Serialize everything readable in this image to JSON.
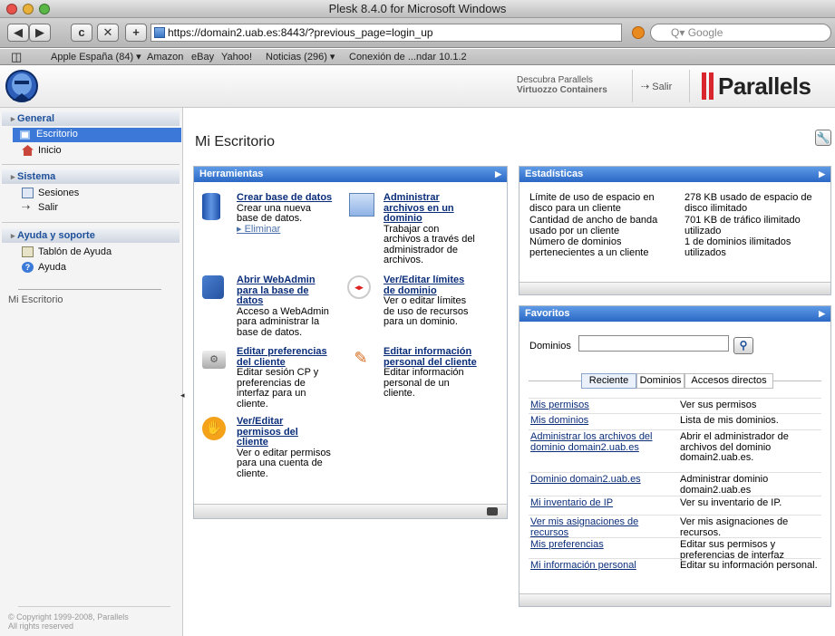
{
  "window": {
    "title": "Plesk 8.4.0 for Microsoft Windows"
  },
  "toolbar": {
    "back": "◀",
    "forward": "▶",
    "reload": "c",
    "stop": "✕",
    "add": "+",
    "url": "https://domain2.uab.es:8443/?previous_page=login_up",
    "search_placeholder": "Q▾ Google"
  },
  "bookmarks": {
    "book_icon": "◫",
    "items": [
      "Apple España (84) ▾",
      "Amazon",
      "eBay",
      "Yahoo!",
      "Noticias (296) ▾",
      "Conexión de ...ndar 10.1.2"
    ]
  },
  "header": {
    "promo_line1": "Descubra Parallels",
    "promo_line2": "Virtuozzo Containers",
    "logout": "Salir",
    "brand": "Parallels"
  },
  "sidebar": {
    "general": "General",
    "escritorio": "Escritorio",
    "inicio": "Inicio",
    "sistema": "Sistema",
    "sesiones": "Sesiones",
    "salir": "Salir",
    "ayuda_soporte": "Ayuda y soporte",
    "tablon": "Tablón de Ayuda",
    "ayuda": "Ayuda",
    "breadcrumb": "Mi Escritorio",
    "copyright1": "© Copyright 1999-2008, Parallels",
    "copyright2": "All rights reserved"
  },
  "main": {
    "title": "Mi Escritorio"
  },
  "tools": {
    "header": "Herramientas",
    "crear_bd": {
      "title": "Crear base de datos",
      "desc1": "Crear una nueva",
      "desc2": "base de datos.",
      "extra": "Eliminar"
    },
    "admin_arch": {
      "t1": "Administrar",
      "t2": "archivos en un",
      "t3": "dominio",
      "d1": "Trabajar con",
      "d2": "archivos a través del",
      "d3": "administrador de",
      "d4": "archivos."
    },
    "webadmin": {
      "t1": "Abrir WebAdmin",
      "t2": "para la base de",
      "t3": "datos",
      "d1": "Acceso a WebAdmin",
      "d2": "para administrar la",
      "d3": "base de datos."
    },
    "limites": {
      "t1": "Ver/Editar límites",
      "t2": "de dominio",
      "d1": "Ver o editar límites",
      "d2": "de uso de recursos",
      "d3": "para un dominio."
    },
    "prefs": {
      "t1": "Editar preferencias",
      "t2": "del cliente",
      "d1": "Editar sesión CP y",
      "d2": "preferencias de",
      "d3": "interfaz para un",
      "d4": "cliente."
    },
    "info": {
      "t1": "Editar información",
      "t2": "personal del cliente",
      "d1": "Editar información",
      "d2": "personal de un",
      "d3": "cliente."
    },
    "permisos": {
      "t1": "Ver/Editar",
      "t2": "permisos del",
      "t3": "cliente",
      "d1": "Ver o editar permisos",
      "d2": "para una cuenta de",
      "d3": "cliente."
    }
  },
  "stats": {
    "header": "Estadísticas",
    "rows": [
      {
        "l1": "Límite de uso de espacio en",
        "l2": "disco para un cliente",
        "v1": "278 KB usado de espacio de",
        "v2": "disco ilimitado"
      },
      {
        "l1": "Cantidad de ancho de banda",
        "l2": "usado por un cliente",
        "v1": "701 KB de tráfico ilimitado",
        "v2": "utilizado"
      },
      {
        "l1": "Número de dominios",
        "l2": "pertenecientes a un cliente",
        "v1": "1 de dominios ilimitados",
        "v2": "utilizados"
      }
    ]
  },
  "favorites": {
    "header": "Favoritos",
    "search_label": "Dominios",
    "search_value": "",
    "tabs": [
      "Reciente",
      "Dominios",
      "Accesos directos"
    ],
    "rows": [
      {
        "link": [
          "Mis permisos"
        ],
        "desc": [
          "Ver sus permisos"
        ]
      },
      {
        "link": [
          "Mis dominios"
        ],
        "desc": [
          "Lista de mis dominios."
        ]
      },
      {
        "link": [
          "Administrar los archivos del",
          "dominio domain2.uab.es"
        ],
        "desc": [
          "Abrir el administrador de",
          "archivos del dominio",
          "domain2.uab.es."
        ]
      },
      {
        "link": [
          "Dominio domain2.uab.es"
        ],
        "desc": [
          "Administrar dominio",
          "domain2.uab.es"
        ]
      },
      {
        "link": [
          "Mi inventario de IP"
        ],
        "desc": [
          "Ver su inventario de IP."
        ]
      },
      {
        "link": [
          "Ver mis asignaciones de",
          "recursos"
        ],
        "desc": [
          "Ver mis asignaciones de",
          "recursos."
        ]
      },
      {
        "link": [
          "Mis preferencias"
        ],
        "desc": [
          "Editar sus permisos y",
          "preferencias de interfaz"
        ]
      },
      {
        "link": [
          "Mi información personal"
        ],
        "desc": [
          "Editar su información personal."
        ]
      }
    ]
  },
  "colors": {
    "header_blue": "#2a68c5",
    "link": "#0a2d7a",
    "brand_red": "#d9262e"
  }
}
